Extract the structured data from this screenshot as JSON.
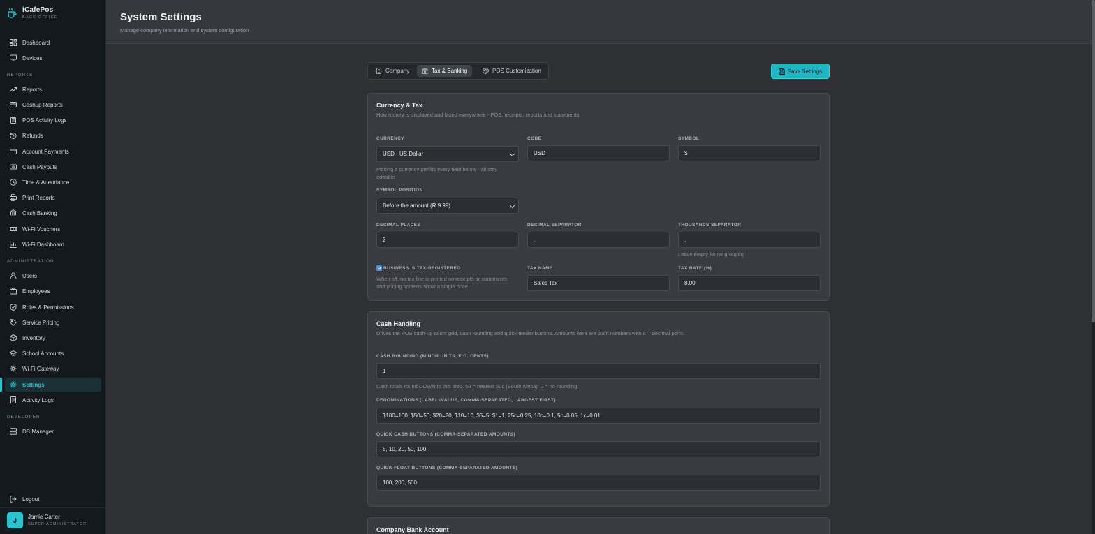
{
  "brand": {
    "name": "iCafePos",
    "subtitle": "BACK OFFICE"
  },
  "sidebar": {
    "main": [
      {
        "label": "Dashboard",
        "icon": "dashboard-icon"
      },
      {
        "label": "Devices",
        "icon": "monitor-icon"
      }
    ],
    "reports_label": "REPORTS",
    "reports": [
      {
        "label": "Reports",
        "icon": "trend-icon"
      },
      {
        "label": "Cashup Reports",
        "icon": "wallet-icon"
      },
      {
        "label": "POS Activity Logs",
        "icon": "clipboard-icon"
      },
      {
        "label": "Refunds",
        "icon": "refund-icon"
      },
      {
        "label": "Account Payments",
        "icon": "card-icon"
      },
      {
        "label": "Cash Payouts",
        "icon": "cash-icon"
      },
      {
        "label": "Time & Attendance",
        "icon": "clock-icon"
      },
      {
        "label": "Print Reports",
        "icon": "printer-icon"
      },
      {
        "label": "Cash Banking",
        "icon": "bank-icon"
      },
      {
        "label": "Wi-Fi Vouchers",
        "icon": "ticket-icon"
      },
      {
        "label": "Wi-Fi Dashboard",
        "icon": "bar-chart-icon"
      }
    ],
    "admin_label": "ADMINISTRATION",
    "admin": [
      {
        "label": "Users",
        "icon": "user-icon"
      },
      {
        "label": "Employees",
        "icon": "briefcase-icon"
      },
      {
        "label": "Roles & Permissions",
        "icon": "shield-icon"
      },
      {
        "label": "Service Pricing",
        "icon": "tag-icon"
      },
      {
        "label": "Inventory",
        "icon": "box-icon"
      },
      {
        "label": "School Accounts",
        "icon": "graduation-icon"
      },
      {
        "label": "Wi-Fi Gateway",
        "icon": "network-icon"
      },
      {
        "label": "Settings",
        "icon": "gear-icon"
      },
      {
        "label": "Activity Logs",
        "icon": "log-icon"
      }
    ],
    "developer_label": "DEVELOPER",
    "developer": [
      {
        "label": "DB Manager",
        "icon": "database-icon"
      }
    ],
    "logout": "Logout"
  },
  "user": {
    "initial": "J",
    "name": "Jamie Carter",
    "role": "SUPER ADMINISTRATOR"
  },
  "header": {
    "title": "System Settings",
    "subtitle": "Manage company information and system configuration"
  },
  "tabs": [
    {
      "label": "Company",
      "icon": "building-icon"
    },
    {
      "label": "Tax & Banking",
      "icon": "bank-icon"
    },
    {
      "label": "POS Customization",
      "icon": "palette-icon"
    }
  ],
  "save_label": "Save Settings",
  "currency_card": {
    "title": "Currency & Tax",
    "description": "How money is displayed and taxed everywhere - POS, receipts, reports and statements",
    "currency_label": "CURRENCY",
    "currency_value": "USD - US Dollar",
    "currency_hint": "Picking a currency prefills every field below - all stay editable",
    "code_label": "CODE",
    "code_value": "USD",
    "symbol_label": "SYMBOL",
    "symbol_value": "$",
    "symbol_position_label": "SYMBOL POSITION",
    "symbol_position_value": "Before the amount (R 9.99)",
    "decimal_places_label": "DECIMAL PLACES",
    "decimal_places_value": "2",
    "decimal_sep_label": "DECIMAL SEPARATOR",
    "decimal_sep_value": ".",
    "thousands_sep_label": "THOUSANDS SEPARATOR",
    "thousands_sep_value": ",",
    "thousands_hint": "Leave empty for no grouping",
    "tax_registered_label": "BUSINESS IS TAX-REGISTERED",
    "tax_registered_checked": true,
    "tax_registered_hint": "When off, no tax line is printed on receipts or statements and pricing screens show a single price",
    "tax_name_label": "TAX NAME",
    "tax_name_value": "Sales Tax",
    "tax_rate_label": "TAX RATE (%)",
    "tax_rate_value": "8.00"
  },
  "cash_card": {
    "title": "Cash Handling",
    "description": "Drives the POS cash-up count grid, cash rounding and quick-tender buttons. Amounts here are plain numbers with a '.' decimal point.",
    "rounding_label": "CASH ROUNDING (MINOR UNITS, E.G. CENTS)",
    "rounding_value": "1",
    "rounding_hint": "Cash totals round DOWN to this step. 50 = nearest 50c (South Africa), 0 = no rounding.",
    "denominations_label": "DENOMINATIONS (LABEL=VALUE, COMMA-SEPARATED, LARGEST FIRST)",
    "denominations_value": "$100=100, $50=50, $20=20, $10=10, $5=5, $1=1, 25c=0.25, 10c=0.1, 5c=0.05, 1c=0.01",
    "quick_cash_label": "QUICK CASH BUTTONS (COMMA-SEPARATED AMOUNTS)",
    "quick_cash_value": "5, 10, 20, 50, 100",
    "quick_float_label": "QUICK FLOAT BUTTONS (COMMA-SEPARATED AMOUNTS)",
    "quick_float_value": "100, 200, 500"
  },
  "bank_card": {
    "title": "Company Bank Account"
  },
  "colors": {
    "accent": "#2bc3cf",
    "sidebar_bg": "#14191d",
    "content_bg": "#2e3034",
    "card_bg": "#383b40"
  }
}
